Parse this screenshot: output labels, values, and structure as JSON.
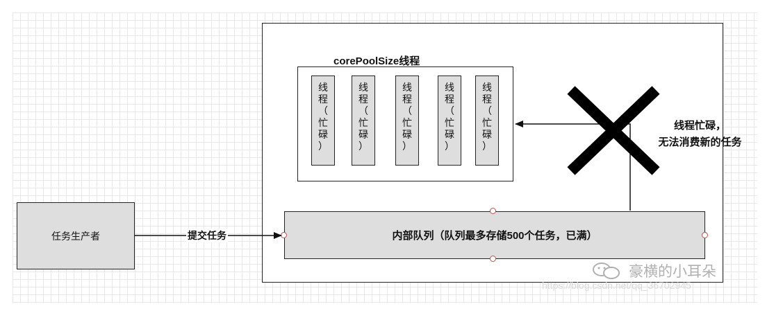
{
  "producer": {
    "label": "任务生产者"
  },
  "edge": {
    "label": "提交任务"
  },
  "core_pool": {
    "title": "corePoolSize线程"
  },
  "threads": [
    {
      "label": "线程（忙碌）"
    },
    {
      "label": "线程（忙碌）"
    },
    {
      "label": "线程（忙碌）"
    },
    {
      "label": "线程（忙碌）"
    },
    {
      "label": "线程（忙碌）"
    }
  ],
  "queue": {
    "label": "内部队列（队列最多存储500个任务，已满）"
  },
  "note": {
    "line1": "线程忙碌，",
    "line2": "无法消费新的任务"
  },
  "watermark": {
    "name": "豪横的小耳朵",
    "url": "https://blog.csdn.net/qq_36702945"
  },
  "colors": {
    "box_fill": "#dedede",
    "port": "#c0504d",
    "cross": "#000000"
  }
}
